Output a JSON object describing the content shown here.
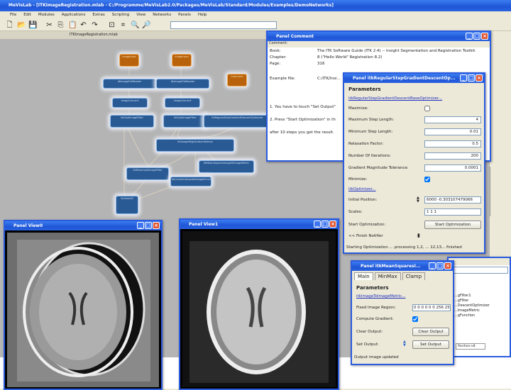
{
  "app": {
    "title": "MeVisLab - [ITKImageRegistration.mlab - C:/Programme/MeVisLab2.0/Packages/MeVisLab/Standard/Modules/Examples/DemoNetworks]"
  },
  "menu": [
    "File",
    "Edit",
    "Modules",
    "Applications",
    "Extras",
    "Scripting",
    "View",
    "Networks",
    "Panels",
    "Help"
  ],
  "toolbar": {
    "icons": [
      "new-icon",
      "open-icon",
      "save-icon",
      "cut-icon",
      "copy-icon",
      "paste-icon",
      "undo-icon",
      "redo-icon",
      "fit-icon",
      "zoom-fit-icon",
      "zoom-in-icon",
      "zoom-out-icon"
    ],
    "search_value": ""
  },
  "network": {
    "tab": "ITKImageRegistration.mlab",
    "nodes": [
      {
        "label": "ImageLoad",
        "type": "orange"
      },
      {
        "label": "ImageLoad",
        "type": "orange"
      },
      {
        "label": "Comment",
        "type": "orange"
      },
      {
        "label": "itkImageFileReader",
        "type": "blue"
      },
      {
        "label": "itkImageFileReader",
        "type": "blue"
      },
      {
        "label": "ImageConvert",
        "type": "blue"
      },
      {
        "label": "ImageConvert",
        "type": "blue"
      },
      {
        "label": "itkCastImageFilter",
        "type": "blue"
      },
      {
        "label": "itkCastImageFilter",
        "type": "blue"
      },
      {
        "label": "itkRegularStepGradientDescentOptimizer",
        "type": "blue"
      },
      {
        "label": "itkImageRegistrationMethod",
        "type": "blue"
      },
      {
        "label": "itkResampleImageFilter",
        "type": "blue"
      },
      {
        "label": "itkMeanSquaresImageToImageMetric",
        "type": "blue"
      },
      {
        "label": "itkLinearInterpolateImageFunction",
        "type": "blue"
      },
      {
        "label": "SoView2D",
        "type": "blue"
      }
    ]
  },
  "comment_panel": {
    "title": "Panel Comment",
    "header": "Comment:",
    "rows": [
      {
        "k": "Book:",
        "v": "The ITK Software Guide (ITK 2.4) -- Insight Segmentation and Registration Toolkit"
      },
      {
        "k": "Chapter:",
        "v": "8 (\"Hello World\" Registration 8.2)"
      },
      {
        "k": "Page:",
        "v": "316"
      },
      {
        "k": "Example file:",
        "v": "C:/ITK/Insi..."
      }
    ],
    "notes": [
      "1. You have to touch \"Set Output\"",
      "2. Press \"Start Optimization\" in th",
      "after 10 steps you get the result."
    ]
  },
  "optimizer_panel": {
    "title": "Panel itkRegularStepGradientDescentOp...",
    "group": "Parameters",
    "link": "itkRegularStepGradientDescentBaseOptimizer...",
    "maximize_label": "Maximize:",
    "maximize": false,
    "fields": [
      {
        "label": "Maximum Step Length:",
        "value": "4"
      },
      {
        "label": "Minimum Step Length:",
        "value": "0.01"
      },
      {
        "label": "Relaxation Factor:",
        "value": "0.5"
      },
      {
        "label": "Number Of Iterations:",
        "value": "200"
      },
      {
        "label": "Gradient Magnitude Tolerance:",
        "value": "0.0001"
      }
    ],
    "minimize_label": "Minimize:",
    "minimize": true,
    "link2": "itkOptimizer...",
    "initial_position_label": "Initial Position:",
    "initial_position": "6000 -0.303107479066",
    "scales_label": "Scales:",
    "scales": "1 1 1",
    "start_label": "Start Optimization:",
    "start_button": "Start Optimization",
    "finish_label": "<< Finish Notifier",
    "status": "Starting Optimization ... processing 1,2, ... 12,13... finished"
  },
  "metric_panel": {
    "title": "Panel itkMeanSquaresI...",
    "tabs": [
      "Main",
      "MinMax",
      "Clamp"
    ],
    "group": "Parameters",
    "link": "itkImageToImageMetric...",
    "fixed_label": "Fixed Image Region:",
    "fixed_value": "0 0 0 0 0 0 256 256 1",
    "compute_label": "Compute Gradient:",
    "compute": true,
    "clear_label": "Clear Output:",
    "clear_button": "Clear Output",
    "set_label": "Set Output:",
    "set_button": "Set Output",
    "status": "Output image updated"
  },
  "view0": {
    "title": "Panel View0"
  },
  "view1": {
    "title": "Panel View1"
  },
  "side_list": [
    "...gFilter1",
    "...gFilter",
    "...DescentOptimizer",
    "...ImageMetric",
    "...gFunction"
  ],
  "side_value": "Position:v8"
}
